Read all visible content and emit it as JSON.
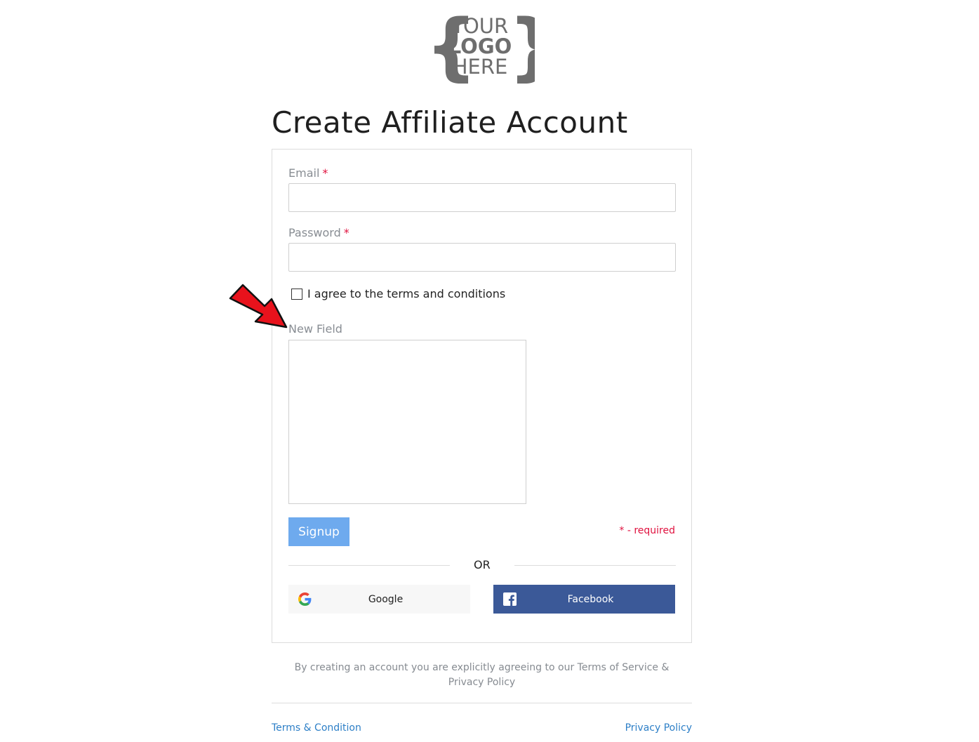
{
  "logo": {
    "line1": "YOUR",
    "line2": "LOGO",
    "line3": "HERE",
    "braces": [
      "{",
      "}"
    ]
  },
  "page_title": "Create Affiliate Account",
  "form": {
    "email": {
      "label": "Email",
      "required_mark": "*",
      "value": ""
    },
    "password": {
      "label": "Password",
      "required_mark": "*",
      "value": ""
    },
    "agree": {
      "label": "I agree to the terms and conditions",
      "checked": false
    },
    "new_field": {
      "label": "New Field",
      "value": ""
    },
    "signup_label": "Signup",
    "required_note": "* - required"
  },
  "divider": {
    "text": "OR"
  },
  "social": {
    "google_label": "Google",
    "facebook_label": "Facebook"
  },
  "disclaimer": {
    "line1": "By creating an account you are explicitly agreeing to our Terms of Service &",
    "line2": "Privacy Policy"
  },
  "footer": {
    "terms_label": "Terms & Condition",
    "privacy_label": "Privacy Policy"
  },
  "colors": {
    "accent_button": "#6eaaee",
    "required": "#e0123f",
    "facebook": "#3b5998",
    "link": "#2d7fc7",
    "annotation_arrow": "#e8121c"
  },
  "icons": [
    "google-icon",
    "facebook-icon",
    "red-arrow-annotation"
  ]
}
